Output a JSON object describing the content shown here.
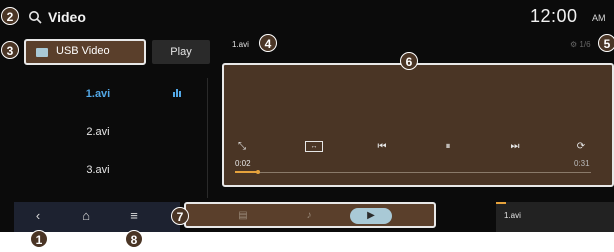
{
  "header": {
    "title": "Video",
    "time": "12:00",
    "ampm": "AM"
  },
  "source": {
    "label": "USB Video",
    "play_label": "Play"
  },
  "files": [
    {
      "name": "1.avi",
      "active": true
    },
    {
      "name": "2.avi",
      "active": false
    },
    {
      "name": "3.avi",
      "active": false
    }
  ],
  "player": {
    "file_name": "1.avi",
    "page_counter": "1/6",
    "current_time": "0:02",
    "total_time": "0:31",
    "progress_fraction": 0.065
  },
  "mini_player": {
    "file_name": "1.avi"
  },
  "badges": [
    "1",
    "2",
    "3",
    "4",
    "5",
    "6",
    "7",
    "8"
  ],
  "colors": {
    "accent": "#e6a23c",
    "highlight": "#53a8e6",
    "panel_brown": "#5a3f2b"
  },
  "icons": {
    "top": "search-icon",
    "controls": [
      "fullscreen-icon",
      "aspect-ratio-icon",
      "previous-track-icon",
      "pause-icon",
      "next-track-icon",
      "repeat-icon"
    ],
    "nav": [
      "back-icon",
      "home-icon",
      "menu-icon"
    ],
    "modes": [
      "radio-icon",
      "music-icon",
      "video-icon"
    ]
  }
}
